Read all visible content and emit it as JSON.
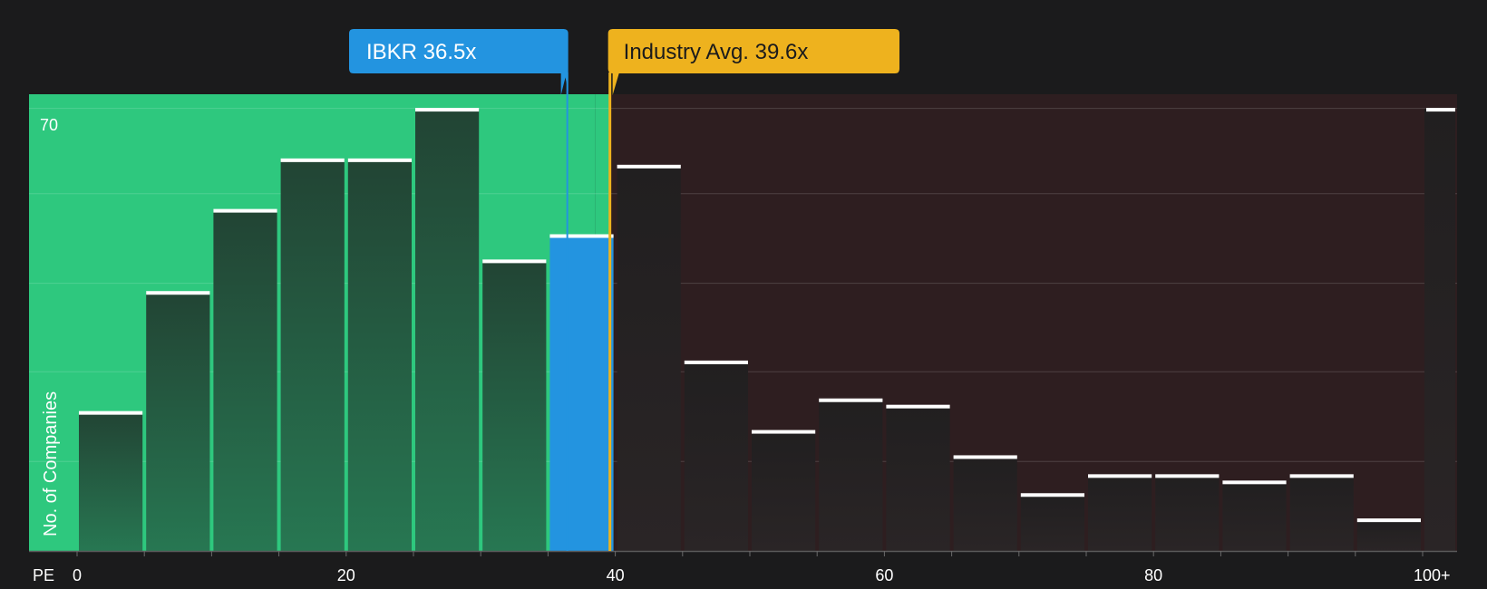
{
  "chart_data": {
    "type": "bar",
    "title": "",
    "xlabel": "PE",
    "ylabel": "No. of Companies",
    "ylim": [
      0,
      72.5
    ],
    "y_tick_label": "70",
    "x_ticks": [
      "0",
      "20",
      "40",
      "60",
      "80",
      "100+"
    ],
    "bin_width": 5,
    "bins": [
      {
        "x_start": 0,
        "x_end": 5,
        "value": 22,
        "zone": "below"
      },
      {
        "x_start": 5,
        "x_end": 10,
        "value": 41,
        "zone": "below"
      },
      {
        "x_start": 10,
        "x_end": 15,
        "value": 54,
        "zone": "below"
      },
      {
        "x_start": 15,
        "x_end": 20,
        "value": 62,
        "zone": "below"
      },
      {
        "x_start": 20,
        "x_end": 25,
        "value": 62,
        "zone": "below"
      },
      {
        "x_start": 25,
        "x_end": 30,
        "value": 70,
        "zone": "below"
      },
      {
        "x_start": 30,
        "x_end": 35,
        "value": 46,
        "zone": "below"
      },
      {
        "x_start": 35,
        "x_end": 40,
        "value": 50,
        "zone": "company"
      },
      {
        "x_start": 40,
        "x_end": 45,
        "value": 61,
        "zone": "above"
      },
      {
        "x_start": 45,
        "x_end": 50,
        "value": 30,
        "zone": "above"
      },
      {
        "x_start": 50,
        "x_end": 55,
        "value": 19,
        "zone": "above"
      },
      {
        "x_start": 55,
        "x_end": 60,
        "value": 24,
        "zone": "above"
      },
      {
        "x_start": 60,
        "x_end": 65,
        "value": 23,
        "zone": "above"
      },
      {
        "x_start": 65,
        "x_end": 70,
        "value": 15,
        "zone": "above"
      },
      {
        "x_start": 70,
        "x_end": 75,
        "value": 9,
        "zone": "above"
      },
      {
        "x_start": 75,
        "x_end": 80,
        "value": 12,
        "zone": "above"
      },
      {
        "x_start": 80,
        "x_end": 85,
        "value": 12,
        "zone": "above"
      },
      {
        "x_start": 85,
        "x_end": 90,
        "value": 11,
        "zone": "above"
      },
      {
        "x_start": 90,
        "x_end": 95,
        "value": 12,
        "zone": "above"
      },
      {
        "x_start": 95,
        "x_end": 100,
        "value": 5,
        "zone": "above"
      },
      {
        "x_start": 100,
        "x_end": 105,
        "value": 70,
        "zone": "above"
      }
    ],
    "company": {
      "label": "IBKR 36.5x",
      "value": 36.5
    },
    "industry": {
      "label": "Industry Avg. 39.6x",
      "value": 39.6
    },
    "grid": true,
    "colors": {
      "background": "#1b1b1c",
      "undervalued_zone": "#2ec87e",
      "overvalued_zone": "#2e1e20",
      "bar_green_top": "#224434",
      "bar_green_bottom": "#277752",
      "bar_dark": "#201f20",
      "company_bar": "#2394e0",
      "company_callout": "#2394e0",
      "industry_callout": "#eeb21e",
      "bar_cap": "#ffffff"
    }
  }
}
